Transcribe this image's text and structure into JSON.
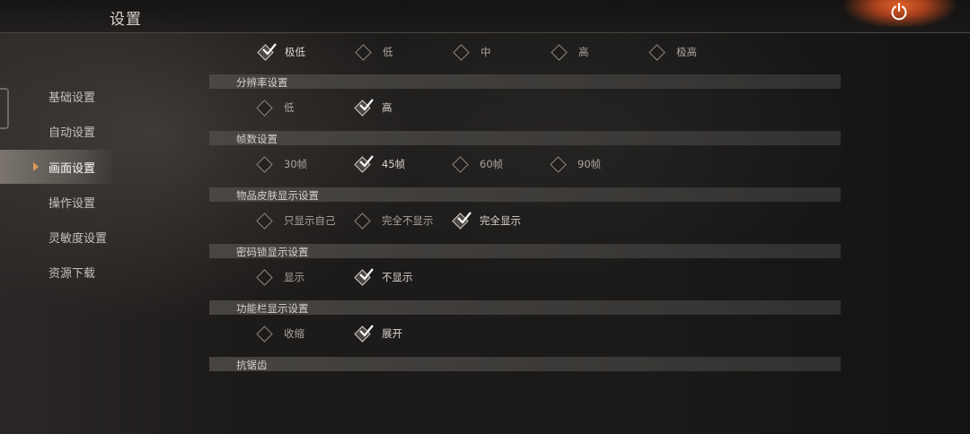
{
  "header": {
    "title": "设置"
  },
  "sidebar": {
    "items": [
      {
        "label": "基础设置",
        "active": false
      },
      {
        "label": "自动设置",
        "active": false
      },
      {
        "label": "画面设置",
        "active": true
      },
      {
        "label": "操作设置",
        "active": false
      },
      {
        "label": "灵敏度设置",
        "active": false
      },
      {
        "label": "资源下载",
        "active": false
      }
    ]
  },
  "settings": {
    "quality": {
      "options": [
        {
          "label": "极低",
          "selected": true
        },
        {
          "label": "低",
          "selected": false
        },
        {
          "label": "中",
          "selected": false
        },
        {
          "label": "高",
          "selected": false
        },
        {
          "label": "极高",
          "selected": false
        }
      ]
    },
    "resolution": {
      "title": "分辨率设置",
      "options": [
        {
          "label": "低",
          "selected": false
        },
        {
          "label": "高",
          "selected": true
        }
      ]
    },
    "framerate": {
      "title": "帧数设置",
      "options": [
        {
          "label": "30帧",
          "selected": false
        },
        {
          "label": "45帧",
          "selected": true
        },
        {
          "label": "60帧",
          "selected": false
        },
        {
          "label": "90帧",
          "selected": false
        }
      ]
    },
    "skin": {
      "title": "物品皮肤显示设置",
      "options": [
        {
          "label": "只显示自己",
          "selected": false
        },
        {
          "label": "完全不显示",
          "selected": false
        },
        {
          "label": "完全显示",
          "selected": true
        }
      ]
    },
    "lock": {
      "title": "密码锁显示设置",
      "options": [
        {
          "label": "显示",
          "selected": false
        },
        {
          "label": "不显示",
          "selected": true
        }
      ]
    },
    "toolbar": {
      "title": "功能栏显示设置",
      "options": [
        {
          "label": "收缩",
          "selected": false
        },
        {
          "label": "展开",
          "selected": true
        }
      ]
    },
    "antialias": {
      "title": "抗锯齿"
    }
  },
  "icons": {
    "power": "power-icon",
    "check": "check-icon",
    "radio": "diamond-radio-icon",
    "arrow": "triangle-right-icon"
  },
  "colors": {
    "accent": "#d89a5a",
    "power_glow": "#e0622a",
    "section_bar": "#4e4b48"
  }
}
